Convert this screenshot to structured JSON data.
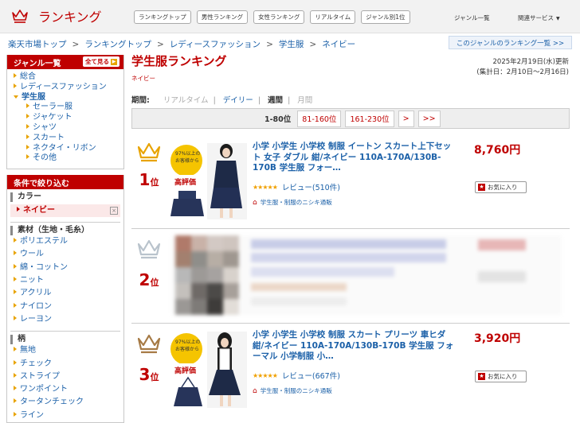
{
  "header": {
    "logo_text": "ランキング",
    "nav": [
      "ランキングトップ",
      "男性ランキング",
      "女性ランキング",
      "リアルタイム",
      "ジャンル別1位"
    ],
    "genre_list_link": "ジャンル一覧",
    "related_services": "関連サービス"
  },
  "breadcrumb": [
    "楽天市場トップ",
    "ランキングトップ",
    "レディースファッション",
    "学生服",
    "ネイビー"
  ],
  "genre_ranking_link": "このジャンルのランキング一覧 >>",
  "sidebar": {
    "genre_head": "ジャンル一覧",
    "show_all": "全て見る",
    "genres": [
      "総合",
      "レディースファッション",
      "学生服"
    ],
    "sub_genres": [
      "セーラー服",
      "ジャケット",
      "シャツ",
      "スカート",
      "ネクタイ・リボン",
      "その他"
    ],
    "filter_head": "条件で絞り込む",
    "color_title": "カラー",
    "color_selected": "ネイビー",
    "material_title": "素材（生地・毛糸）",
    "materials": [
      "ポリエステル",
      "ウール",
      "綿・コットン",
      "ニット",
      "アクリル",
      "ナイロン",
      "レーヨン"
    ],
    "pattern_title": "柄",
    "patterns": [
      "無地",
      "チェック",
      "ストライプ",
      "ワンポイント",
      "タータンチェック",
      "ライン"
    ]
  },
  "main": {
    "title": "学生服ランキング",
    "subtitle": "ネイビー",
    "date_line1": "2025年2月19日(水)更新",
    "date_line2": "(集計日：2月10日～2月16日)",
    "period_label": "期間:",
    "periods": [
      "リアルタイム",
      "デイリー",
      "週間",
      "月間"
    ],
    "pages": [
      "1-80位",
      "81-160位",
      "161-230位",
      ">",
      ">>"
    ]
  },
  "items": [
    {
      "rank": "1",
      "rank_suffix": "位",
      "title": "小学 小学生 小学校 制服 イートン スカート上下セット 女子 ダブル 紺/ネイビー 110A-170A/130B-170B 学生服 フォー…",
      "review": "レビュー(510件)",
      "shop": "学生服・制服のニシキ通販",
      "price": "8,760円",
      "fav": "お気に入り",
      "badge_line1": "97%以上の",
      "badge_line2": "お客様から",
      "badge_line3": "高評価"
    },
    {
      "rank": "2",
      "rank_suffix": "位"
    },
    {
      "rank": "3",
      "rank_suffix": "位",
      "title": "小学 小学生 小学校 制服 スカート プリーツ 車ヒダ 紺/ネイビー 110A-170A/130B-170B 学生服 フォーマル 小学制服 小…",
      "review": "レビュー(667件)",
      "shop": "学生服・制服のニシキ通販",
      "price": "3,920円",
      "fav": "お気に入り",
      "badge_line1": "97%以上の",
      "badge_line2": "お客様から",
      "badge_line3": "高評価"
    }
  ],
  "colors": {
    "accent": "#bf0000",
    "link": "#1b60a8",
    "gold": "#e8a300",
    "silver": "#b9c3cc",
    "bronze": "#a67a45"
  }
}
